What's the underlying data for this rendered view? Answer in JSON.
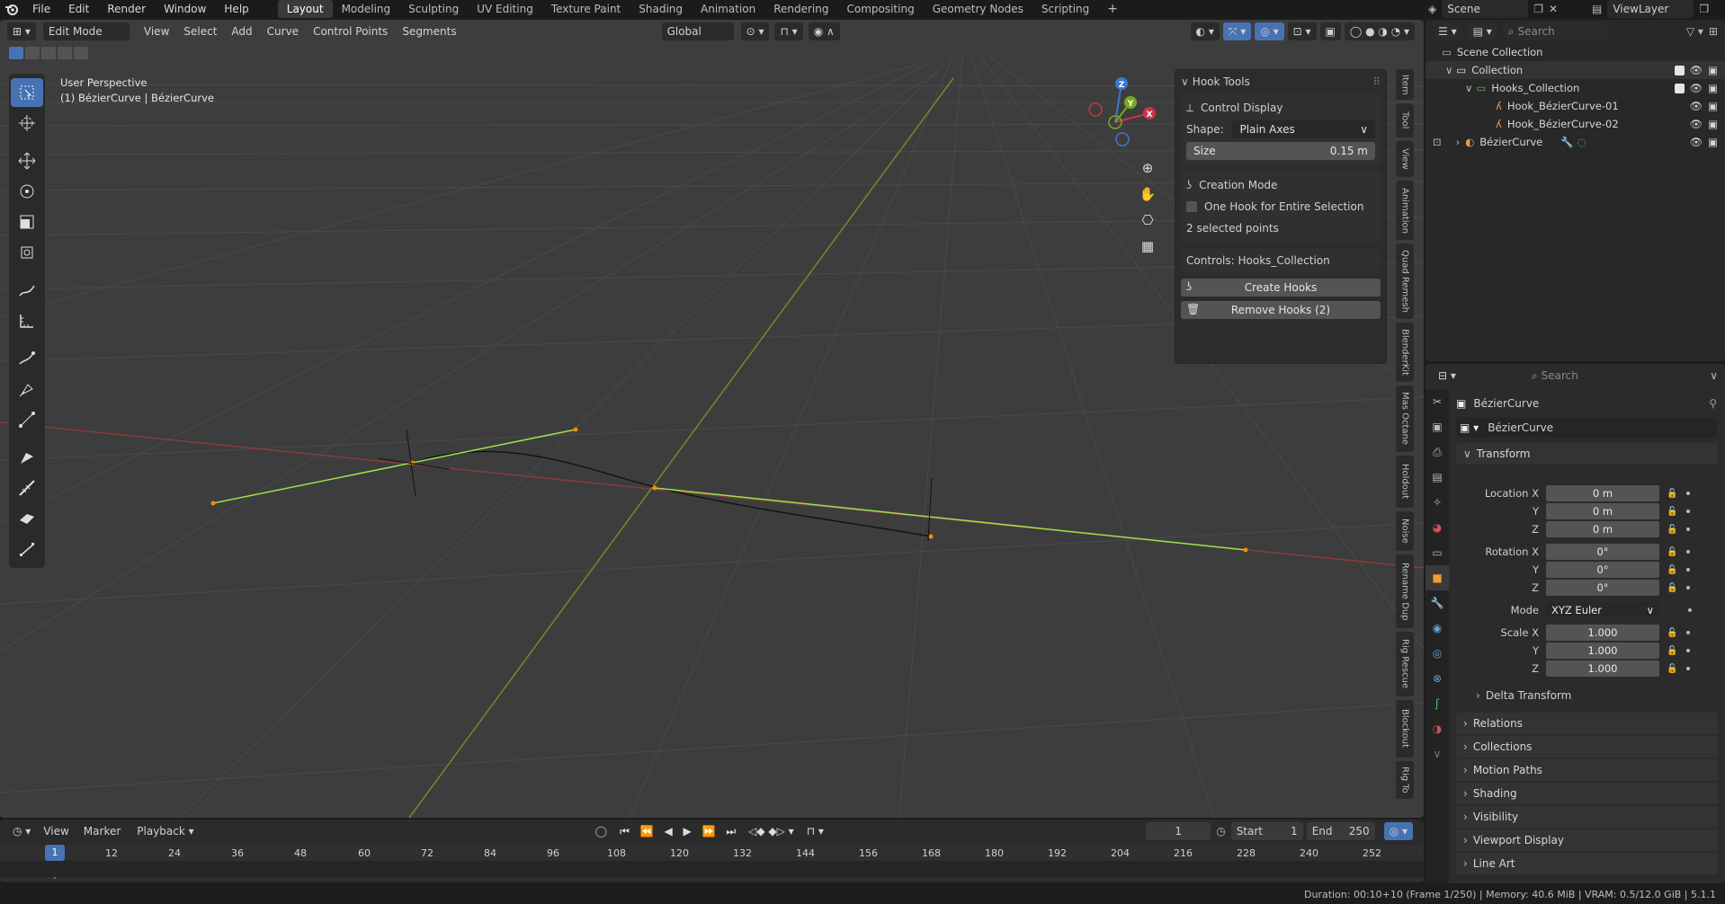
{
  "menubar": {
    "menus": [
      "File",
      "Edit",
      "Render",
      "Window",
      "Help"
    ],
    "workspaces": [
      "Layout",
      "Modeling",
      "Sculpting",
      "UV Editing",
      "Texture Paint",
      "Shading",
      "Animation",
      "Rendering",
      "Compositing",
      "Geometry Nodes",
      "Scripting"
    ],
    "active_workspace": "Layout",
    "scene_label": "Scene",
    "viewlayer_label": "ViewLayer"
  },
  "viewport": {
    "mode": "Edit Mode",
    "menus": [
      "View",
      "Select",
      "Add",
      "Curve",
      "Control Points",
      "Segments"
    ],
    "transform_orientation": "Global",
    "overlay_title": "User Perspective",
    "overlay_subtitle": "(1) BézierCurve | BézierCurve",
    "side_tabs": [
      "Item",
      "Tool",
      "View",
      "Animation",
      "Quad Remesh",
      "BlenderKit",
      "Mas Octane",
      "Holdout",
      "Noise",
      "Rename Dup",
      "Rig Rescue",
      "Blockout",
      "Rig To"
    ]
  },
  "hook_panel": {
    "title": "Hook Tools",
    "control_display": "Control Display",
    "shape_label": "Shape:",
    "shape_value": "Plain Axes",
    "size_label": "Size",
    "size_value": "0.15 m",
    "creation_mode": "Creation Mode",
    "one_hook_label": "One Hook for Entire Selection",
    "selected_points": "2 selected points",
    "controls_label": "Controls: Hooks_Collection",
    "create_button": "Create Hooks",
    "remove_button": "Remove Hooks (2)"
  },
  "outliner": {
    "search_placeholder": "Search",
    "scene_collection": "Scene Collection",
    "collection": "Collection",
    "hooks_collection": "Hooks_Collection",
    "hook1": "Hook_BézierCurve-01",
    "hook2": "Hook_BézierCurve-02",
    "curve": "BézierCurve"
  },
  "properties": {
    "search_placeholder": "Search",
    "object_name": "BézierCurve",
    "data_name": "BézierCurve",
    "transform_title": "Transform",
    "location_label": "Location X",
    "location": [
      "0 m",
      "0 m",
      "0 m"
    ],
    "rotation_label": "Rotation X",
    "rotation": [
      "0°",
      "0°",
      "0°"
    ],
    "mode_label": "Mode",
    "mode_value": "XYZ Euler",
    "scale_label": "Scale X",
    "scale": [
      "1.000",
      "1.000",
      "1.000"
    ],
    "axis_y": "Y",
    "axis_z": "Z",
    "delta_transform": "Delta Transform",
    "sections": [
      "Relations",
      "Collections",
      "Motion Paths",
      "Shading",
      "Visibility",
      "Viewport Display",
      "Line Art"
    ]
  },
  "timeline": {
    "menus": [
      "View",
      "Marker",
      "Playback"
    ],
    "current_frame": "1",
    "start_label": "Start",
    "start": "1",
    "end_label": "End",
    "end": "250",
    "ruler": [
      "1",
      "12",
      "24",
      "36",
      "48",
      "60",
      "72",
      "84",
      "96",
      "108",
      "120",
      "132",
      "144",
      "156",
      "168",
      "180",
      "192",
      "204",
      "216",
      "228",
      "240",
      "252"
    ]
  },
  "status": {
    "text": "Duration: 00:10+10 (Frame 1/250) | Memory: 40.6 MiB | VRAM: 0.5/12.0 GiB | 5.1.1"
  }
}
